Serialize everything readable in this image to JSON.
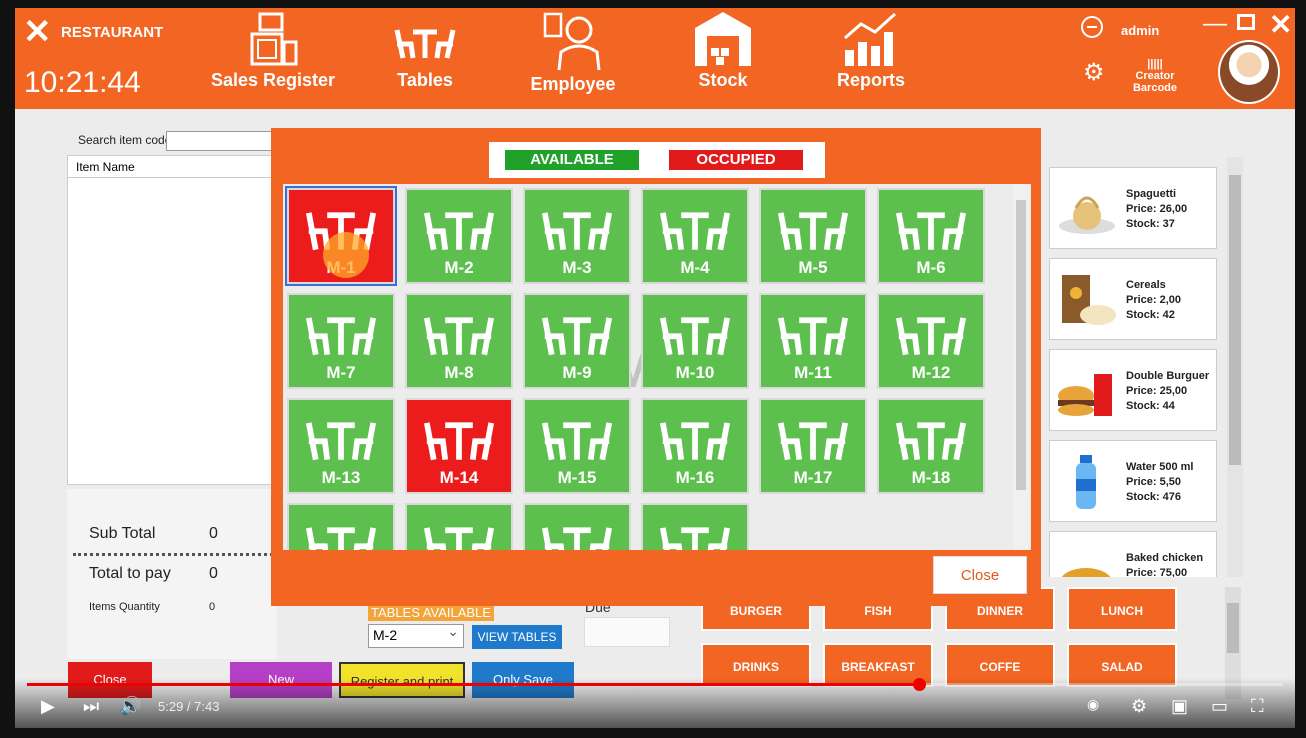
{
  "header": {
    "app_name": "RESTAURANT",
    "clock": "10:21:44",
    "nav": [
      {
        "label": "Sales Register",
        "icon": "cash-register-icon"
      },
      {
        "label": "Tables",
        "icon": "table-chairs-icon"
      },
      {
        "label": "Employee",
        "icon": "employee-icon"
      },
      {
        "label": "Stock",
        "icon": "warehouse-icon"
      },
      {
        "label": "Reports",
        "icon": "bar-chart-icon"
      }
    ],
    "user": "admin",
    "barcode_label": "Creator Barcode"
  },
  "pos": {
    "search_label": "Search item code",
    "item_name_header": "Item Name",
    "subtotal_label": "Sub Total",
    "subtotal_value": "0",
    "total_label": "Total to pay",
    "total_value": "0",
    "qty_label": "Items Quantity",
    "qty_value": "0",
    "tables_available_label": "TABLES AVAILABLE",
    "selected_table": "M-2",
    "view_tables_label": "VIEW TABLES",
    "due_label": "Due",
    "buttons": {
      "close": "Close",
      "new": "New",
      "register_print": "Register and print",
      "only_save": "Only Save"
    },
    "categories": [
      "BURGER",
      "FISH",
      "DINNER",
      "LUNCH",
      "DRINKS",
      "BREAKFAST",
      "COFFE",
      "SALAD"
    ]
  },
  "products": [
    {
      "name": "Spaguetti",
      "price": "Price: 26,00",
      "stock": "Stock: 37"
    },
    {
      "name": "Cereals",
      "price": "Price: 2,00",
      "stock": "Stock: 42"
    },
    {
      "name": "Double Burguer",
      "price": "Price: 25,00",
      "stock": "Stock: 44"
    },
    {
      "name": "Water 500 ml",
      "price": "Price: 5,50",
      "stock": "Stock: 476"
    },
    {
      "name": "Baked chicken",
      "price": "Price: 75,00",
      "stock": ""
    }
  ],
  "modal": {
    "legend_available": "AVAILABLE",
    "legend_occupied": "OCCUPIED",
    "watermark": "M-1",
    "close_label": "Close",
    "tables": [
      {
        "label": "M-1",
        "status": "occupied",
        "selected": true
      },
      {
        "label": "M-2",
        "status": "available"
      },
      {
        "label": "M-3",
        "status": "available"
      },
      {
        "label": "M-4",
        "status": "available"
      },
      {
        "label": "M-5",
        "status": "available"
      },
      {
        "label": "M-6",
        "status": "available"
      },
      {
        "label": "M-7",
        "status": "available"
      },
      {
        "label": "M-8",
        "status": "available"
      },
      {
        "label": "M-9",
        "status": "available"
      },
      {
        "label": "M-10",
        "status": "available"
      },
      {
        "label": "M-11",
        "status": "available"
      },
      {
        "label": "M-12",
        "status": "available"
      },
      {
        "label": "M-13",
        "status": "available"
      },
      {
        "label": "M-14",
        "status": "occupied"
      },
      {
        "label": "M-15",
        "status": "available"
      },
      {
        "label": "M-16",
        "status": "available"
      },
      {
        "label": "M-17",
        "status": "available"
      },
      {
        "label": "M-18",
        "status": "available"
      },
      {
        "label": "",
        "status": "available"
      },
      {
        "label": "",
        "status": "available"
      },
      {
        "label": "",
        "status": "available"
      },
      {
        "label": "",
        "status": "available"
      }
    ]
  },
  "video": {
    "time": "5:29 / 7:43",
    "progress": 0.71
  },
  "colors": {
    "brand": "#f26522",
    "available": "#5cbf4e",
    "occupied": "#ed1c1c"
  }
}
